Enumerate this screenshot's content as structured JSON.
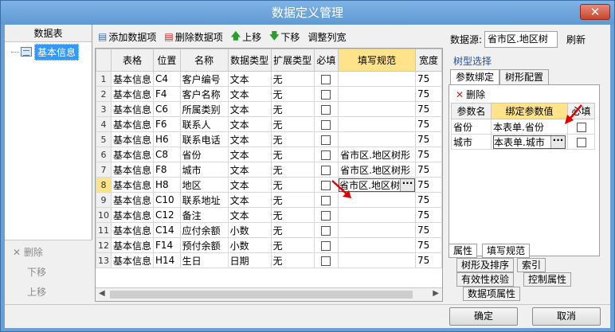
{
  "window": {
    "title": "数据定义管理"
  },
  "left": {
    "header": "数据表",
    "tree_item": "基本信息",
    "actions": {
      "delete": "删除",
      "move_down": "下移",
      "move_up": "上移"
    }
  },
  "toolbar": {
    "add": "添加数据项",
    "delete": "删除数据项",
    "move_up": "上移",
    "move_down": "下移",
    "adjust": "调整列宽"
  },
  "grid": {
    "columns": [
      "表格",
      "位置",
      "名称",
      "数据类型",
      "扩展类型",
      "必填",
      "填写规范",
      "宽度"
    ],
    "rows": [
      {
        "n": "1",
        "table": "基本信息",
        "pos": "C4",
        "name": "客户编号",
        "type": "文本",
        "ext": "无",
        "rule": "",
        "width": "75"
      },
      {
        "n": "2",
        "table": "基本信息",
        "pos": "F4",
        "name": "客户名称",
        "type": "文本",
        "ext": "无",
        "rule": "",
        "width": "75"
      },
      {
        "n": "3",
        "table": "基本信息",
        "pos": "C6",
        "name": "所属类别",
        "type": "文本",
        "ext": "无",
        "rule": "",
        "width": "75"
      },
      {
        "n": "4",
        "table": "基本信息",
        "pos": "F6",
        "name": "联系人",
        "type": "文本",
        "ext": "无",
        "rule": "",
        "width": "75"
      },
      {
        "n": "5",
        "table": "基本信息",
        "pos": "H6",
        "name": "联系电话",
        "type": "文本",
        "ext": "无",
        "rule": "",
        "width": "75"
      },
      {
        "n": "6",
        "table": "基本信息",
        "pos": "C8",
        "name": "省份",
        "type": "文本",
        "ext": "无",
        "rule": "省市区.地区树形",
        "width": "75"
      },
      {
        "n": "7",
        "table": "基本信息",
        "pos": "F8",
        "name": "城市",
        "type": "文本",
        "ext": "无",
        "rule": "省市区.地区树形",
        "width": "75"
      },
      {
        "n": "8",
        "table": "基本信息",
        "pos": "H8",
        "name": "地区",
        "type": "文本",
        "ext": "无",
        "rule": "省市区.地区树",
        "width": "75"
      },
      {
        "n": "9",
        "table": "基本信息",
        "pos": "C10",
        "name": "联系地址",
        "type": "文本",
        "ext": "无",
        "rule": "",
        "width": "75"
      },
      {
        "n": "10",
        "table": "基本信息",
        "pos": "C12",
        "name": "备注",
        "type": "文本",
        "ext": "无",
        "rule": "",
        "width": "75"
      },
      {
        "n": "11",
        "table": "基本信息",
        "pos": "C14",
        "name": "应付余额",
        "type": "小数",
        "ext": "无",
        "rule": "",
        "width": "75"
      },
      {
        "n": "12",
        "table": "基本信息",
        "pos": "F14",
        "name": "预付余额",
        "type": "小数",
        "ext": "无",
        "rule": "",
        "width": "75"
      },
      {
        "n": "13",
        "table": "基本信息",
        "pos": "H14",
        "name": "生日",
        "type": "日期",
        "ext": "无",
        "rule": "",
        "width": "75"
      }
    ]
  },
  "right": {
    "datasource_label": "数据源:",
    "datasource_value": "省市区.地区树",
    "refresh": "刷新",
    "tree_select": "树型选择",
    "tabs": [
      "参数绑定",
      "树形配置"
    ],
    "delete": "删除",
    "param_columns": [
      "参数名",
      "绑定参数值",
      "必填"
    ],
    "params": [
      {
        "name": "省份",
        "value": "本表单.省份"
      },
      {
        "name": "城市",
        "value": "本表单.城市"
      }
    ],
    "bottom_tabs": [
      "属性",
      "填写规范",
      "树形及排序",
      "索引",
      "有效性校验",
      "控制属性",
      "数据项属性"
    ]
  },
  "footer": {
    "ok": "确定",
    "cancel": "取消"
  },
  "colors": {
    "header_active": "#ffe38a",
    "title_bar": "#6aa0d6",
    "close": "#c9452e"
  }
}
